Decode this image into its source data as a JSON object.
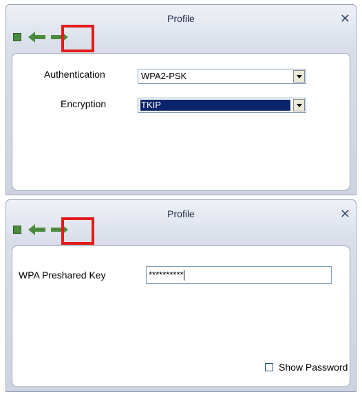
{
  "panels": [
    {
      "title": "Profile",
      "close_symbol": "✕",
      "toolbar": {
        "icons": [
          "stop-icon",
          "back-arrow-icon",
          "forward-arrow-icon"
        ],
        "highlight_color": "#e31b1b"
      },
      "fields": {
        "authentication_label": "Authentication",
        "authentication_value": "WPA2-PSK",
        "encryption_label": "Encryption",
        "encryption_value": "TKIP"
      }
    },
    {
      "title": "Profile",
      "close_symbol": "✕",
      "toolbar": {
        "icons": [
          "stop-icon",
          "back-arrow-icon",
          "forward-arrow-icon"
        ],
        "highlight_color": "#e31b1b"
      },
      "fields": {
        "wpa_key_label": "WPA Preshared Key",
        "wpa_key_value": "**********",
        "show_password_label": "Show Password",
        "show_password_checked": false
      }
    }
  ]
}
